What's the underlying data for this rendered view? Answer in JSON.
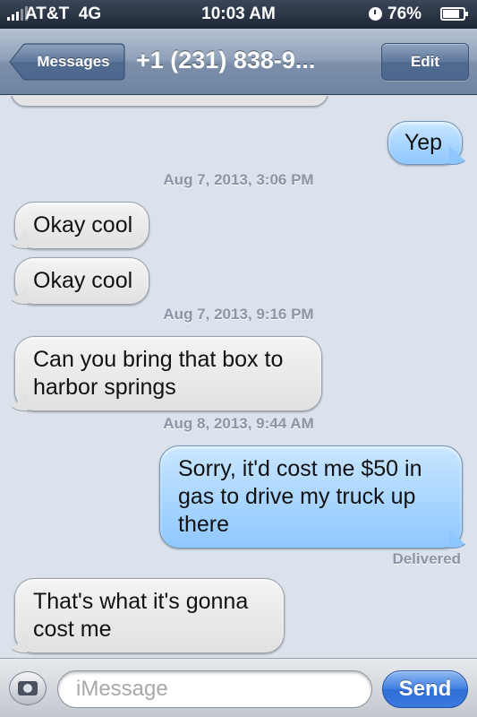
{
  "status_bar": {
    "carrier": "AT&T",
    "network": "4G",
    "time": "10:03 AM",
    "battery": "76%"
  },
  "nav": {
    "back_label": "Messages",
    "title": "+1 (231) 838-9...",
    "edit_label": "Edit"
  },
  "conversation": {
    "messages": [
      {
        "kind": "out",
        "text": "Yep"
      },
      {
        "kind": "timestamp",
        "text": "Aug 7, 2013, 3:06 PM"
      },
      {
        "kind": "in",
        "text": "Okay cool"
      },
      {
        "kind": "in",
        "text": "Okay cool"
      },
      {
        "kind": "timestamp",
        "text": "Aug 7, 2013, 9:16 PM"
      },
      {
        "kind": "in",
        "text": "Can you bring that box to harbor springs"
      },
      {
        "kind": "timestamp",
        "text": "Aug 8, 2013, 9:44 AM"
      },
      {
        "kind": "out",
        "text": "Sorry, it'd cost me $50 in gas to drive my truck up there"
      },
      {
        "kind": "status",
        "text": "Delivered"
      },
      {
        "kind": "in",
        "text": "That's what it's gonna cost me"
      }
    ]
  },
  "composer": {
    "placeholder": "iMessage",
    "send_label": "Send",
    "camera_icon": "camera-icon"
  },
  "colors": {
    "background": "#dbe2ec",
    "outgoing_bubble": "#8ec7ff",
    "incoming_bubble": "#e1e1e1",
    "send_button": "#3b7ae0"
  }
}
